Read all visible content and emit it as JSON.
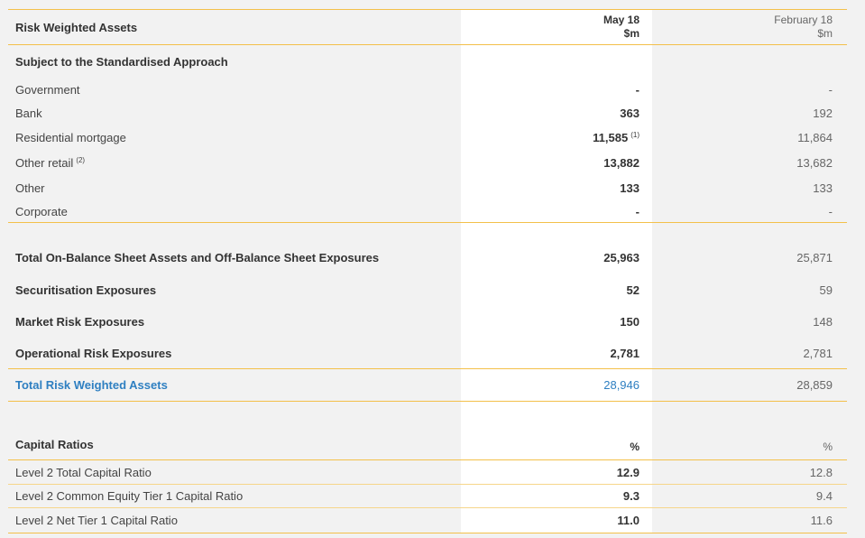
{
  "header": {
    "title": "Risk Weighted Assets",
    "col1_line1": "May 18",
    "col1_line2": "$m",
    "col2_line1": "February 18",
    "col2_line2": "$m"
  },
  "section_standardised": {
    "title": "Subject to the Standardised Approach",
    "rows": [
      {
        "label": "Government",
        "sup": "",
        "may": "-",
        "may_sup": "",
        "feb": "-"
      },
      {
        "label": "Bank",
        "sup": "",
        "may": "363",
        "may_sup": "",
        "feb": "192"
      },
      {
        "label": "Residential mortgage",
        "sup": "",
        "may": "11,585",
        "may_sup": "(1)",
        "feb": "11,864"
      },
      {
        "label": "Other retail",
        "sup": "(2)",
        "may": "13,882",
        "may_sup": "",
        "feb": "13,682"
      },
      {
        "label": "Other",
        "sup": "",
        "may": "133",
        "may_sup": "",
        "feb": "133"
      },
      {
        "label": "Corporate",
        "sup": "",
        "may": "-",
        "may_sup": "",
        "feb": "-"
      }
    ]
  },
  "totals": [
    {
      "label": "Total On-Balance Sheet Assets and Off-Balance Sheet Exposures",
      "may": "25,963",
      "feb": "25,871"
    },
    {
      "label": "Securitisation Exposures",
      "may": "52",
      "feb": "59"
    },
    {
      "label": "Market Risk Exposures",
      "may": "150",
      "feb": "148"
    },
    {
      "label": "Operational Risk Exposures",
      "may": "2,781",
      "feb": "2,781"
    }
  ],
  "total_rwa": {
    "label": "Total Risk Weighted Assets",
    "may": "28,946",
    "feb": "28,859"
  },
  "capital": {
    "title": "Capital Ratios",
    "col1": "%",
    "col2": "%",
    "rows": [
      {
        "label": "Level 2 Total Capital Ratio",
        "may": "12.9",
        "feb": "12.8"
      },
      {
        "label": "Level 2 Common Equity Tier 1 Capital Ratio",
        "may": "9.3",
        "feb": "9.4"
      },
      {
        "label": "Level 2 Net Tier 1 Capital Ratio",
        "may": "11.0",
        "feb": "11.6"
      }
    ]
  },
  "colors": {
    "accent_line": "#f3c04a",
    "highlight": "#2e7fc1",
    "background": "#f2f2f2"
  }
}
